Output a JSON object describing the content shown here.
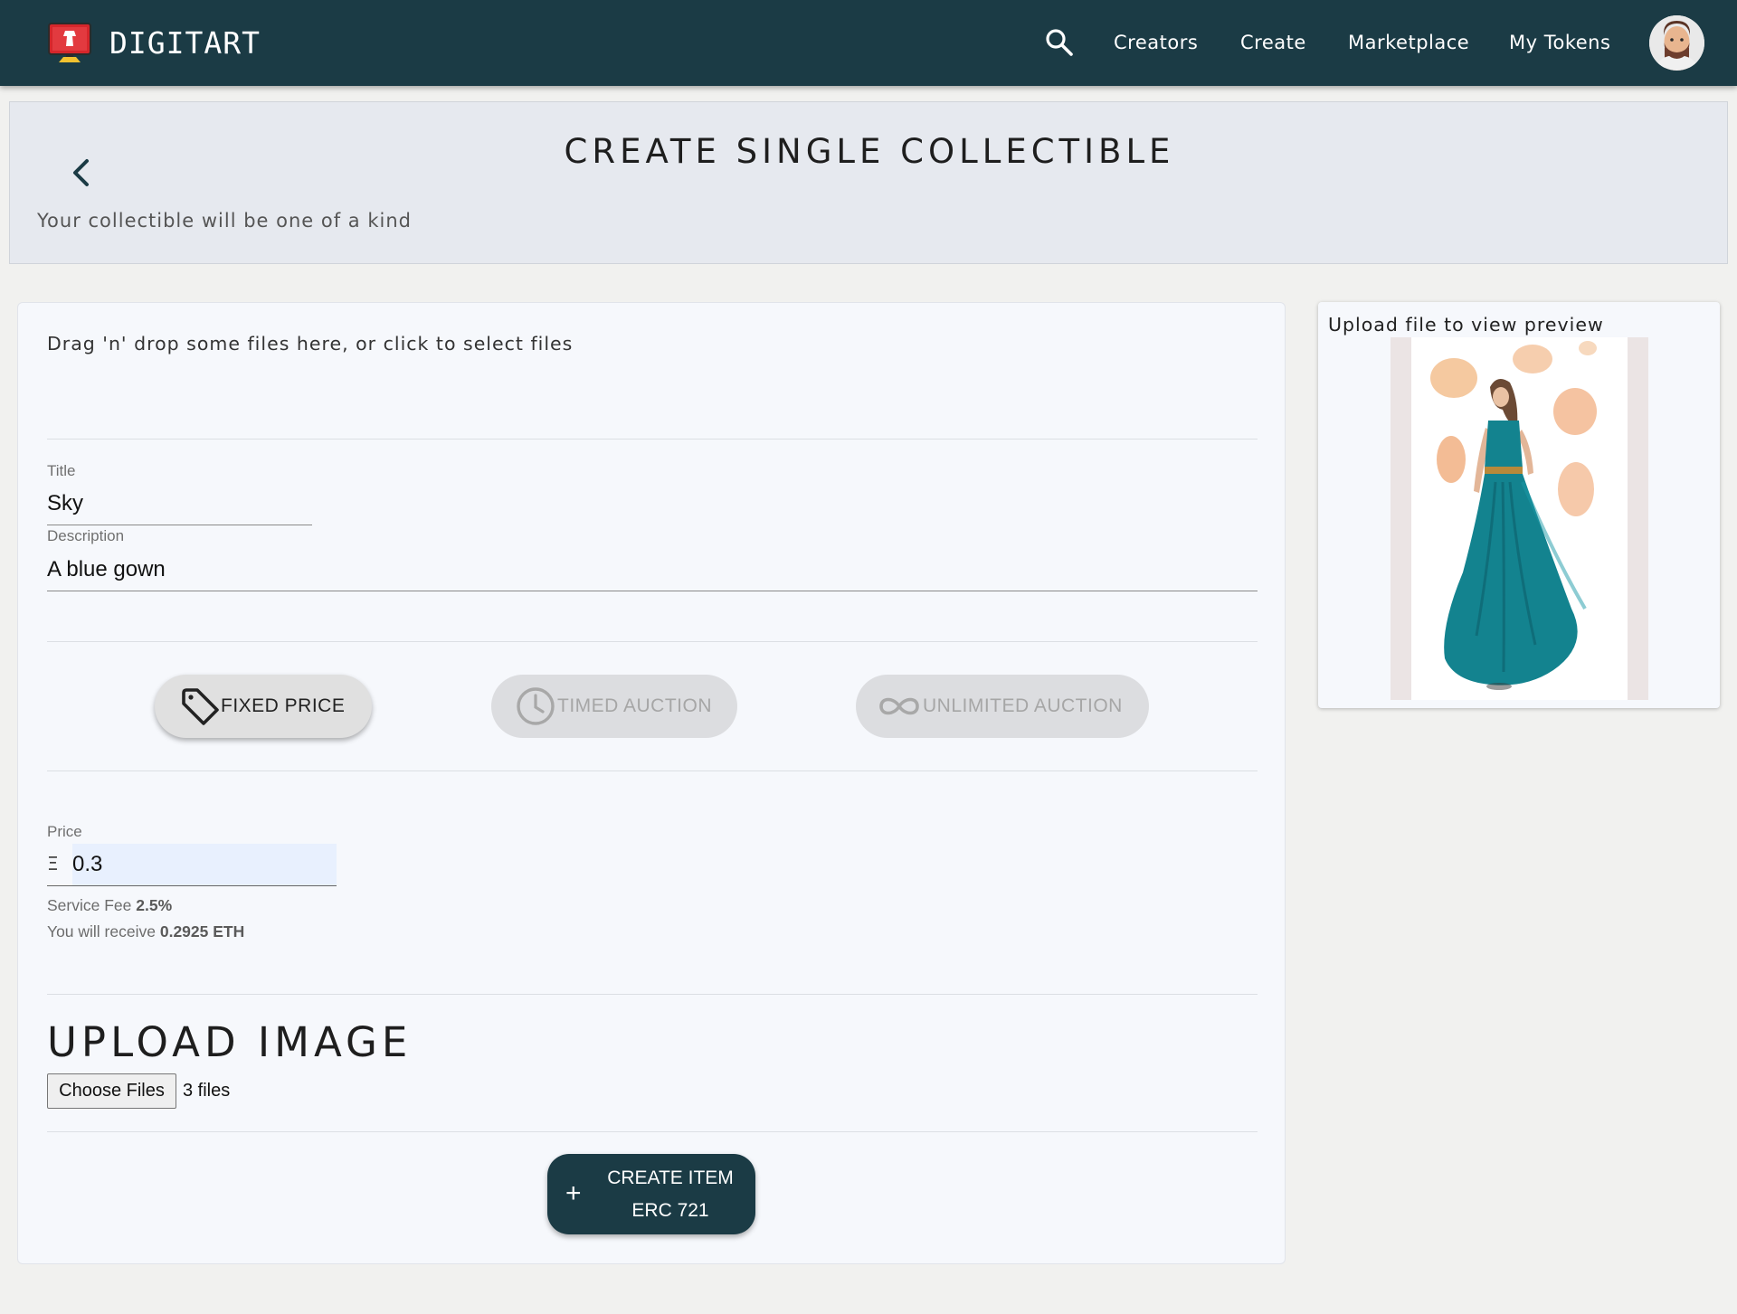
{
  "app": {
    "brand": "DIGITART"
  },
  "nav": {
    "search_icon": "search-icon",
    "links": [
      "Creators",
      "Create",
      "Marketplace",
      "My Tokens"
    ]
  },
  "header": {
    "title": "CREATE SINGLE COLLECTIBLE",
    "subtitle": "Your collectible will be one of a kind"
  },
  "dropzone": {
    "text": "Drag 'n' drop some files here, or click to select files"
  },
  "form": {
    "title_label": "Title",
    "title_value": "Sky",
    "description_label": "Description",
    "description_value": "A blue gown"
  },
  "sale_options": [
    {
      "label": "FIXED PRICE",
      "icon": "tag-icon",
      "selected": true
    },
    {
      "label": "TIMED AUCTION",
      "icon": "clock-icon",
      "selected": false
    },
    {
      "label": "UNLIMITED AUCTION",
      "icon": "infinity-icon",
      "selected": false
    }
  ],
  "price": {
    "label": "Price",
    "currency_symbol": "Ξ",
    "value": "0.3",
    "fee_prefix": "Service Fee",
    "fee_value": "2.5%",
    "receive_prefix": "You will receive",
    "receive_value": "0.2925 ETH"
  },
  "upload": {
    "title": "UPLOAD IMAGE",
    "choose_label": "Choose Files",
    "file_count": "3 files"
  },
  "create_button": {
    "line1": "CREATE ITEM",
    "line2": "ERC 721",
    "icon": "plus-icon"
  },
  "preview": {
    "title": "Upload file to view preview"
  },
  "colors": {
    "appbar": "#1b3b45",
    "page_bg": "#f1f1ef",
    "card_bg": "#f6f8fc",
    "header_bg": "#e6e9ef",
    "gown": "#13838f"
  }
}
